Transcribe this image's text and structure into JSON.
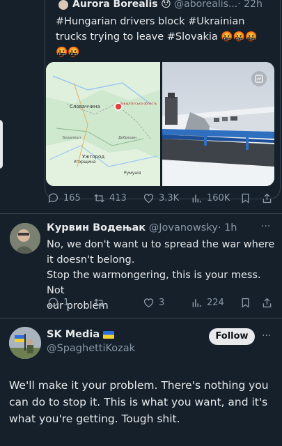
{
  "quoted": {
    "display_name": "Aurora Borealis",
    "name_emoji": "😯",
    "handle": "@aborealis...",
    "age": "· 22h",
    "text_line1": "#Hungarian drivers block #Ukrainian",
    "text_line2": "trucks trying to leave #Slovakia",
    "emojis_line2": "🤬🤬🤬",
    "emojis_line3": "🤬🤬",
    "map": {
      "labels": [
        "Словаччина",
        "Закарпатська область",
        "Ужгород",
        "Угорщина",
        "Румунія",
        "Будапешт",
        "Дебрецен"
      ]
    },
    "metrics": {
      "replies": "165",
      "reposts": "413",
      "likes": "3.3K",
      "views": "160K"
    }
  },
  "reply": {
    "display_name": "Курвин Водењак",
    "handle": "@Jovanowsky",
    "age": "· 1h",
    "lines": [
      "No, we don't want u to spread the war where",
      "it doesn't belong.",
      "Stop the warmongering, this is your mess. Not",
      "our problem"
    ],
    "metrics": {
      "replies": "1",
      "reposts": "",
      "likes": "3",
      "views": "224"
    },
    "more": "···"
  },
  "main_post": {
    "display_name": "SK Media",
    "flag_colors": {
      "top": "#2f6fdc",
      "bottom": "#f2d233"
    },
    "handle": "@SpaghettiKozak",
    "follow_label": "Follow",
    "more": "···",
    "text_lines": [
      "We'll make it your problem. There's nothing you",
      "can do to stop it. This is what you want, and it's",
      "what you're getting. Tough shit."
    ]
  },
  "colors": {
    "background": "#15202b",
    "muted": "#8b98a5",
    "divider": "#38444d",
    "accent": "#1d9bf0"
  }
}
